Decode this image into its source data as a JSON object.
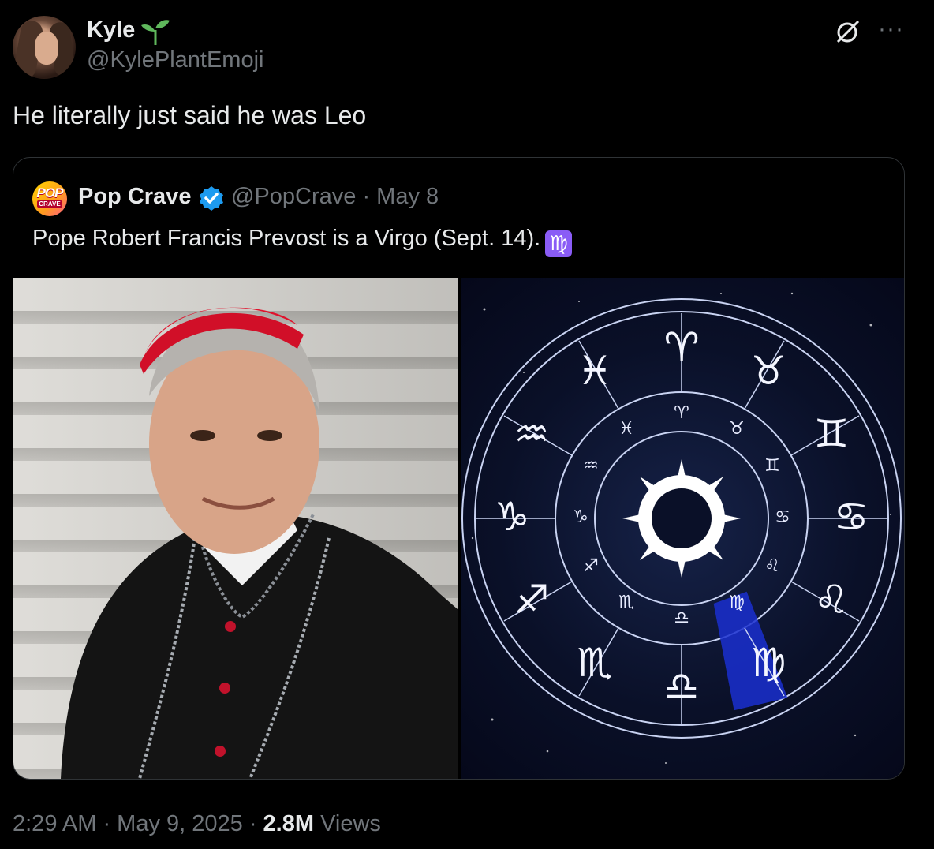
{
  "tweet": {
    "author_name": "Kyle",
    "author_emoji": "seedling-icon",
    "author_handle": "@KylePlantEmoji",
    "text": "He literally just said he was Leo",
    "timestamp": "2:29 AM · May 9, 2025 · ",
    "views_count": "2.8M",
    "views_label": " Views"
  },
  "quote": {
    "author_name": "Pop Crave",
    "author_handle_date": "@PopCrave · May 8",
    "text": "Pope Robert Francis Prevost is a Virgo (Sept. 14).",
    "emoji": "♍",
    "logo_top": "POP",
    "logo_bottom": "CRAVE",
    "media": [
      {
        "description_icon": "photo-icon"
      },
      {
        "description_icon": "zodiac-wheel-icon"
      }
    ]
  },
  "zodiac": {
    "signs": [
      "♈",
      "♉",
      "♊",
      "♋",
      "♌",
      "♍",
      "♎",
      "♏",
      "♐",
      "♑",
      "♒",
      "♓"
    ],
    "highlight_color": "#1a2fd0"
  },
  "colors": {
    "background": "#000000",
    "text_primary": "#e7e9ea",
    "text_secondary": "#71767b",
    "verified": "#1d9bf0",
    "sprout": "#5fb85c",
    "border": "#2f3336"
  }
}
